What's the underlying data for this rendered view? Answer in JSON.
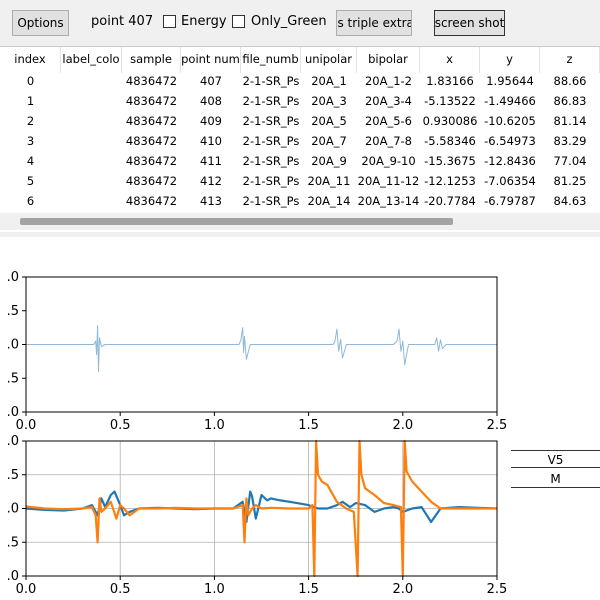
{
  "toolbar": {
    "options_label": "Options",
    "point_label": "point 407",
    "energy_label": "Energy",
    "energy_checked": false,
    "only_green_label": "Only_Green",
    "only_green_checked": false,
    "triple_label": "is triple extra",
    "screenshot_label": "screen shot"
  },
  "table": {
    "columns": [
      "index",
      "label_colo",
      "sample",
      "point num",
      "file_numb",
      "unipolar",
      "bipolar",
      "x",
      "y",
      "z"
    ],
    "rows": [
      [
        "0",
        "",
        "4836472",
        "407",
        "2-1-SR_Ps",
        "20A_1",
        "20A_1-2",
        "1.83166",
        "1.95644",
        "88.66"
      ],
      [
        "1",
        "",
        "4836472",
        "408",
        "2-1-SR_Ps",
        "20A_3",
        "20A_3-4",
        "-5.13522",
        "-1.49466",
        "86.83"
      ],
      [
        "2",
        "",
        "4836472",
        "409",
        "2-1-SR_Ps",
        "20A_5",
        "20A_5-6",
        "0.930086",
        "-10.6205",
        "81.14"
      ],
      [
        "3",
        "",
        "4836472",
        "410",
        "2-1-SR_Ps",
        "20A_7",
        "20A_7-8",
        "-5.58346",
        "-6.54973",
        "83.29"
      ],
      [
        "4",
        "",
        "4836472",
        "411",
        "2-1-SR_Ps",
        "20A_9",
        "20A_9-10",
        "-15.3675",
        "-12.8436",
        "77.04"
      ],
      [
        "5",
        "",
        "4836472",
        "412",
        "2-1-SR_Ps",
        "20A_11",
        "20A_11-12",
        "-12.1253",
        "-7.06354",
        "81.25"
      ],
      [
        "6",
        "",
        "4836472",
        "413",
        "2-1-SR_Ps",
        "20A_14",
        "20A_13-14",
        "-20.7784",
        "-6.79787",
        "84.63"
      ]
    ]
  },
  "legend": {
    "items": [
      "V5",
      "M"
    ]
  },
  "chart_data": [
    {
      "type": "line",
      "xlim": [
        0.0,
        2.5
      ],
      "ylim": [
        -1.0,
        1.0
      ],
      "xticks": [
        "0.0",
        "0.5",
        "1.0",
        "1.5",
        "2.0",
        "2.5"
      ],
      "yticks": [
        ".0",
        ".5",
        ".0",
        ".5",
        ".0"
      ],
      "grid": false,
      "series": [
        {
          "color": "#8fb9d9",
          "x": [
            0.0,
            0.36,
            0.37,
            0.375,
            0.38,
            0.385,
            0.39,
            0.4,
            0.42,
            1.13,
            1.14,
            1.15,
            1.155,
            1.16,
            1.17,
            1.19,
            1.63,
            1.64,
            1.65,
            1.66,
            1.67,
            1.68,
            1.7,
            1.95,
            1.97,
            1.98,
            1.99,
            2.0,
            2.01,
            2.03,
            2.17,
            2.18,
            2.19,
            2.2,
            2.21,
            2.23,
            2.5
          ],
          "y": [
            0.0,
            0.0,
            0.05,
            -0.15,
            0.28,
            -0.4,
            0.1,
            -0.03,
            0.0,
            0.0,
            0.06,
            0.25,
            -0.12,
            0.12,
            -0.22,
            0.0,
            0.0,
            0.05,
            0.23,
            -0.1,
            0.08,
            -0.2,
            0.0,
            0.0,
            0.05,
            0.23,
            -0.1,
            0.05,
            -0.3,
            0.0,
            0.0,
            0.1,
            -0.1,
            0.07,
            -0.06,
            0.0,
            0.0
          ]
        }
      ]
    },
    {
      "type": "line",
      "xlim": [
        0.0,
        2.5
      ],
      "ylim": [
        -1.0,
        1.0
      ],
      "xticks": [
        "0.0",
        "0.5",
        "1.0",
        "1.5",
        "2.0",
        "2.5"
      ],
      "yticks": [
        ".0",
        ".5",
        ".0",
        ".5",
        ".0"
      ],
      "grid": true,
      "series": [
        {
          "color": "#1f77b4",
          "x": [
            0.0,
            0.1,
            0.2,
            0.3,
            0.35,
            0.38,
            0.4,
            0.42,
            0.45,
            0.47,
            0.5,
            0.52,
            0.55,
            0.6,
            0.7,
            0.8,
            0.9,
            1.0,
            1.1,
            1.15,
            1.17,
            1.19,
            1.2,
            1.22,
            1.25,
            1.28,
            1.3,
            1.35,
            1.4,
            1.5,
            1.55,
            1.6,
            1.65,
            1.68,
            1.72,
            1.75,
            1.8,
            1.85,
            1.9,
            1.95,
            1.98,
            2.0,
            2.05,
            2.1,
            2.15,
            2.2,
            2.3,
            2.4,
            2.5
          ],
          "y": [
            0.0,
            -0.02,
            -0.03,
            0.0,
            0.05,
            -0.1,
            0.15,
            0.02,
            0.2,
            0.25,
            0.05,
            -0.1,
            -0.05,
            0.0,
            0.01,
            0.0,
            -0.01,
            0.0,
            0.0,
            0.1,
            -0.2,
            0.25,
            0.18,
            -0.15,
            0.2,
            0.12,
            0.15,
            0.12,
            0.1,
            0.05,
            0.0,
            0.0,
            0.05,
            0.1,
            0.02,
            0.08,
            0.05,
            -0.05,
            0.0,
            0.02,
            0.0,
            -0.05,
            0.0,
            0.02,
            -0.2,
            0.0,
            0.02,
            0.01,
            0.0
          ]
        },
        {
          "color": "#ff7f0e",
          "x": [
            0.0,
            0.1,
            0.2,
            0.3,
            0.35,
            0.37,
            0.38,
            0.39,
            0.4,
            0.42,
            0.45,
            0.48,
            0.5,
            0.52,
            0.55,
            0.6,
            0.7,
            0.8,
            0.9,
            1.0,
            1.1,
            1.15,
            1.16,
            1.17,
            1.18,
            1.2,
            1.22,
            1.25,
            1.3,
            1.4,
            1.5,
            1.52,
            1.53,
            1.54,
            1.55,
            1.57,
            1.6,
            1.65,
            1.7,
            1.74,
            1.76,
            1.77,
            1.78,
            1.8,
            1.85,
            1.9,
            1.95,
            1.99,
            2.0,
            2.01,
            2.02,
            2.05,
            2.1,
            2.15,
            2.2,
            2.3,
            2.4,
            2.5
          ],
          "y": [
            0.03,
            0.0,
            -0.01,
            0.0,
            0.02,
            -0.1,
            -0.5,
            0.15,
            -0.05,
            0.0,
            0.1,
            -0.15,
            0.05,
            0.0,
            -0.1,
            0.0,
            0.0,
            0.01,
            0.0,
            0.0,
            0.0,
            0.05,
            -0.5,
            0.15,
            -0.1,
            0.0,
            0.05,
            0.0,
            0.01,
            0.0,
            0.0,
            0.05,
            -1.0,
            1.0,
            0.5,
            0.4,
            0.35,
            0.1,
            0.0,
            -0.05,
            -1.0,
            1.0,
            0.5,
            0.3,
            0.2,
            0.08,
            0.05,
            0.02,
            -1.0,
            1.0,
            0.55,
            0.4,
            0.25,
            0.1,
            0.0,
            0.0,
            0.0,
            0.0
          ]
        }
      ]
    }
  ]
}
